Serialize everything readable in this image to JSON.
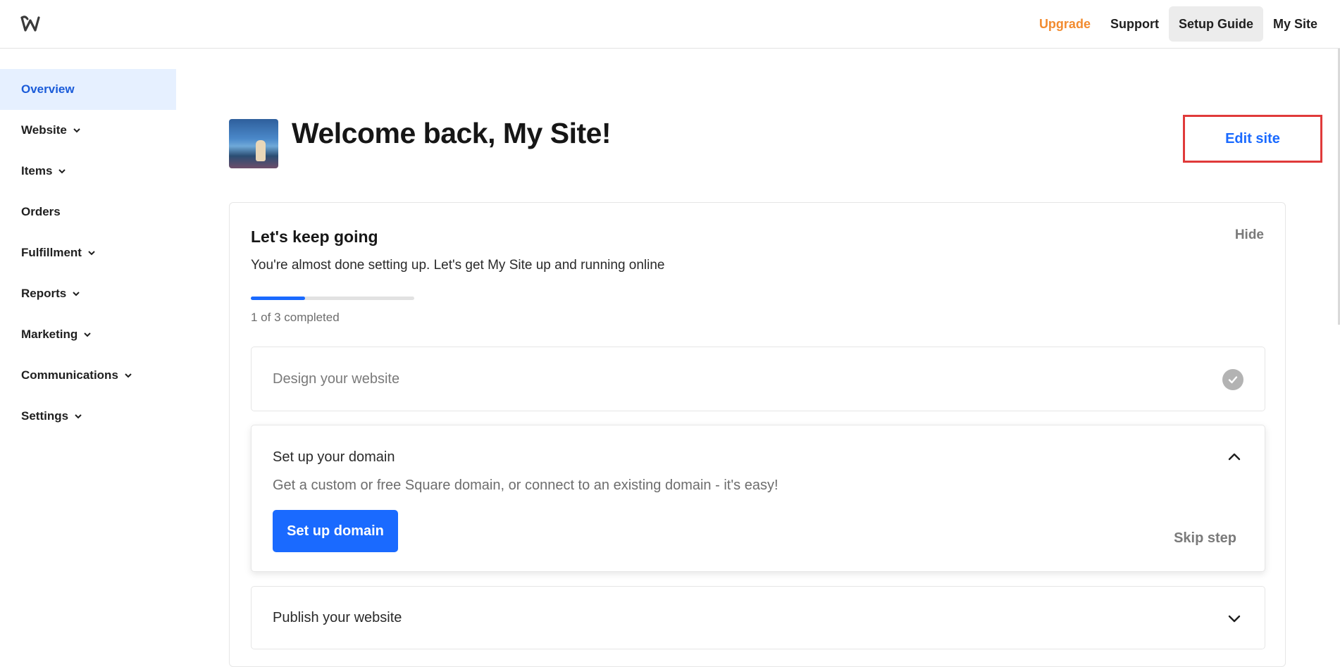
{
  "topbar": {
    "logo_icon": "weebly-w-logo",
    "nav": [
      {
        "label": "Upgrade",
        "color": "#f28b2f"
      },
      {
        "label": "Support"
      },
      {
        "label": "Setup Guide",
        "active": true
      },
      {
        "label": "My Site"
      }
    ]
  },
  "sidebar": {
    "items": [
      {
        "label": "Overview",
        "active": true,
        "has_chevron": false
      },
      {
        "label": "Website",
        "has_chevron": true
      },
      {
        "label": "Items",
        "has_chevron": true
      },
      {
        "label": "Orders",
        "has_chevron": false
      },
      {
        "label": "Fulfillment",
        "has_chevron": true
      },
      {
        "label": "Reports",
        "has_chevron": true
      },
      {
        "label": "Marketing",
        "has_chevron": true
      },
      {
        "label": "Communications",
        "has_chevron": true
      },
      {
        "label": "Settings",
        "has_chevron": true
      }
    ]
  },
  "header": {
    "title": "Welcome back, My Site!",
    "edit_label": "Edit site"
  },
  "setup": {
    "title": "Let's keep going",
    "hide_label": "Hide",
    "subtitle": "You're almost done setting up. Let's get My Site up and running online",
    "progress_fraction": 0.33,
    "progress_text": "1 of 3 completed",
    "steps": [
      {
        "label": "Design your website",
        "status": "completed",
        "icon": "check-circle-icon"
      },
      {
        "label": "Set up your domain",
        "status": "expanded",
        "icon": "chevron-up-icon",
        "description": "Get a custom or free Square domain, or connect to an existing domain - it's easy!",
        "button": "Set up domain",
        "skip": "Skip step"
      },
      {
        "label": "Publish your website",
        "status": "collapsed",
        "icon": "chevron-down-icon"
      }
    ]
  },
  "colors": {
    "accent": "#1a6aff",
    "upgrade": "#f28b2f",
    "sidebar_active_bg": "#e6f0ff",
    "highlight_border": "#e03a3a"
  }
}
